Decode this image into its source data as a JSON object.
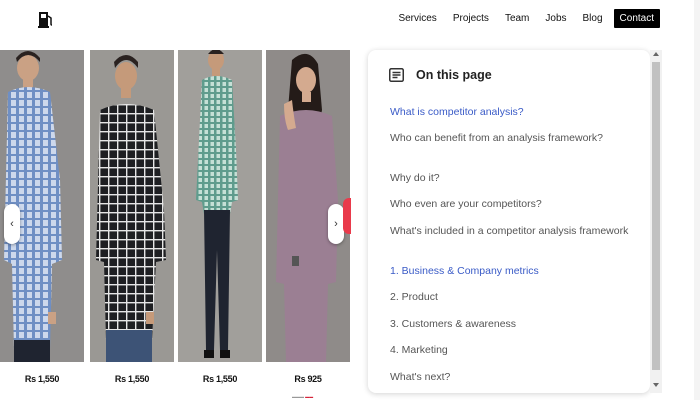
{
  "header": {
    "logo_icon": "fuel-pump-icon",
    "nav": [
      {
        "label": "Services"
      },
      {
        "label": "Projects"
      },
      {
        "label": "Team"
      },
      {
        "label": "Jobs"
      },
      {
        "label": "Blog"
      },
      {
        "label": "Contact"
      }
    ]
  },
  "products": [
    {
      "price": "Rs 1,550",
      "shirt_color": "#8ea6cc"
    },
    {
      "price": "Rs 1,550",
      "shirt_color": "#2b2d31"
    },
    {
      "price": "Rs 1,550",
      "shirt_color": "#7fb3a7"
    },
    {
      "price": "Rs 925",
      "shirt_color": "#9b7f93"
    }
  ],
  "carousel": {
    "prev_icon": "chevron-left-icon",
    "next_icon": "chevron-right-icon",
    "prev_glyph": "‹",
    "next_glyph": "›"
  },
  "toc": {
    "title": "On this page",
    "icon": "document-list-icon",
    "items": [
      {
        "label": "What is competitor analysis?",
        "active": true
      },
      {
        "label": "Who can benefit from an analysis framework?"
      },
      {
        "label": "Why do it?"
      },
      {
        "label": "Who even are your competitors?"
      },
      {
        "label": "What's included in a competitor analysis framework"
      },
      {
        "label": "1. Business & Company metrics",
        "highlight": true
      },
      {
        "label": "2. Product"
      },
      {
        "label": "3. Customers & awareness"
      },
      {
        "label": "4. Marketing"
      },
      {
        "label": "What's next?"
      }
    ]
  },
  "colors": {
    "accent": "#3a5bc7",
    "contact_bg": "#000000",
    "red_tab": "#e93a4b"
  }
}
